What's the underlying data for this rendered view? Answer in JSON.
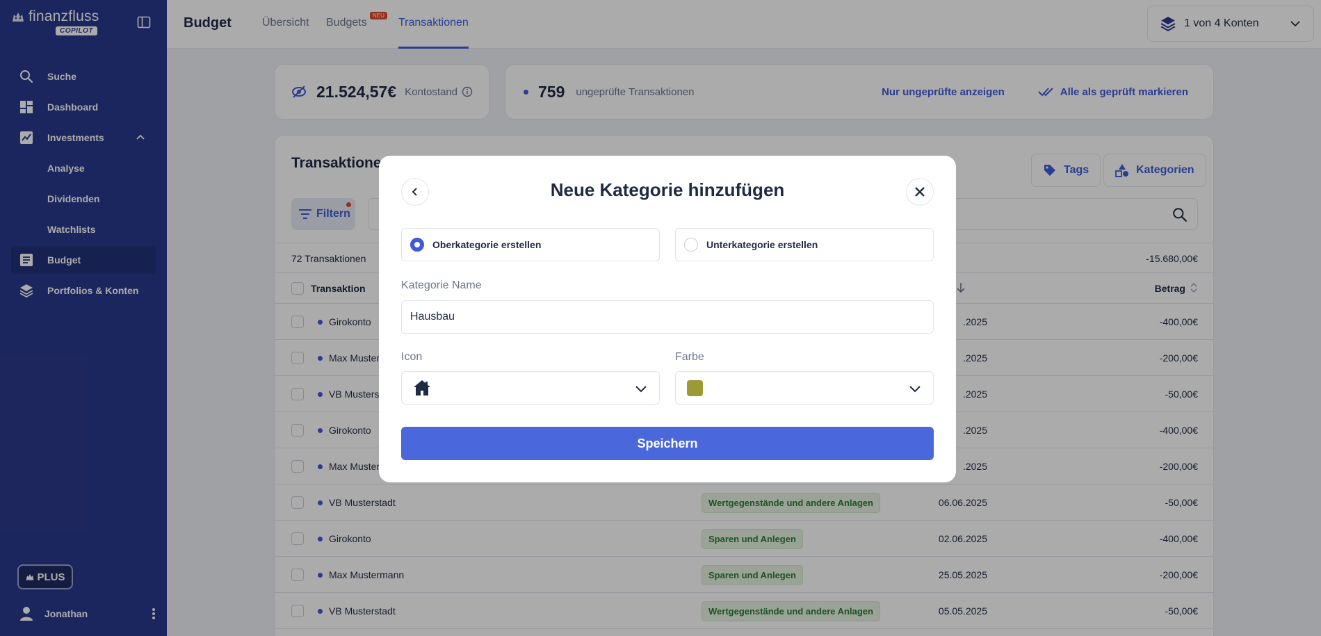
{
  "brand": {
    "name": "finanzfluss",
    "badge": "COPILOT"
  },
  "sidebar": {
    "items": [
      {
        "label": "Suche",
        "icon": "search-icon"
      },
      {
        "label": "Dashboard",
        "icon": "dashboard-icon"
      },
      {
        "label": "Investments",
        "icon": "chart-line-icon"
      },
      {
        "label": "Analyse"
      },
      {
        "label": "Dividenden"
      },
      {
        "label": "Watchlists"
      },
      {
        "label": "Budget",
        "icon": "budget-icon"
      },
      {
        "label": "Portfolios & Konten",
        "icon": "layers-icon"
      }
    ],
    "plus_label": "PLUS",
    "user_name": "Jonathan"
  },
  "topbar": {
    "title": "Budget",
    "tabs": [
      {
        "label": "Übersicht"
      },
      {
        "label": "Budgets",
        "badge": "NEU"
      },
      {
        "label": "Transaktionen"
      }
    ],
    "account_selector": "1 von 4 Konten"
  },
  "summary": {
    "balance_value": "21.524,57€",
    "balance_label": "Kontostand",
    "unchecked_count": "759",
    "unchecked_label": "ungeprüfte Transaktionen",
    "only_unchecked_link": "Nur ungeprüfte anzeigen",
    "mark_all_link": "Alle als geprüft markieren"
  },
  "transactions": {
    "title": "Transaktionen",
    "tags_button": "Tags",
    "categories_button": "Kategorien",
    "filter_button": "Filtern",
    "count_label": "72 Transaktionen",
    "total": "-15.680,00€",
    "col_transaction": "Transaktion",
    "col_amount": "Betrag",
    "rows": [
      {
        "name": "Girokonto",
        "category": "",
        "date": ".2025",
        "amount": "-400,00€"
      },
      {
        "name": "Max Musterm",
        "category": "",
        "date": ".2025",
        "amount": "-200,00€"
      },
      {
        "name": "VB Musterst",
        "category": "",
        "date": ".2025",
        "amount": "-50,00€"
      },
      {
        "name": "Girokonto",
        "category": "",
        "date": ".2025",
        "amount": "-400,00€"
      },
      {
        "name": "Max Muster",
        "category": "",
        "date": ".2025",
        "amount": "-200,00€"
      },
      {
        "name": "VB Musterstadt",
        "category": "Wertgegenstände und andere Anlagen",
        "date": "06.06.2025",
        "amount": "-50,00€"
      },
      {
        "name": "Girokonto",
        "category": "Sparen und Anlegen",
        "date": "02.06.2025",
        "amount": "-400,00€"
      },
      {
        "name": "Max Mustermann",
        "category": "Sparen und Anlegen",
        "date": "25.05.2025",
        "amount": "-200,00€"
      },
      {
        "name": "VB Musterstadt",
        "category": "Wertgegenstände und andere Anlagen",
        "date": "05.05.2025",
        "amount": "-50,00€"
      }
    ]
  },
  "modal": {
    "title": "Neue Kategorie hinzufügen",
    "option_main": "Oberkategorie erstellen",
    "option_sub": "Unterkategorie erstellen",
    "selected_option": "Oberkategorie erstellen",
    "name_label": "Kategorie Name",
    "name_value": "Hausbau",
    "icon_label": "Icon",
    "icon_value": "house-icon",
    "color_label": "Farbe",
    "color_value": "#9b9a35",
    "save_label": "Speichern"
  },
  "colors": {
    "sidebar_bg": "#2b3a8c",
    "accent": "#3f5bd8",
    "save_button": "#4a68dc",
    "category_badge_text": "#2f7a35"
  }
}
